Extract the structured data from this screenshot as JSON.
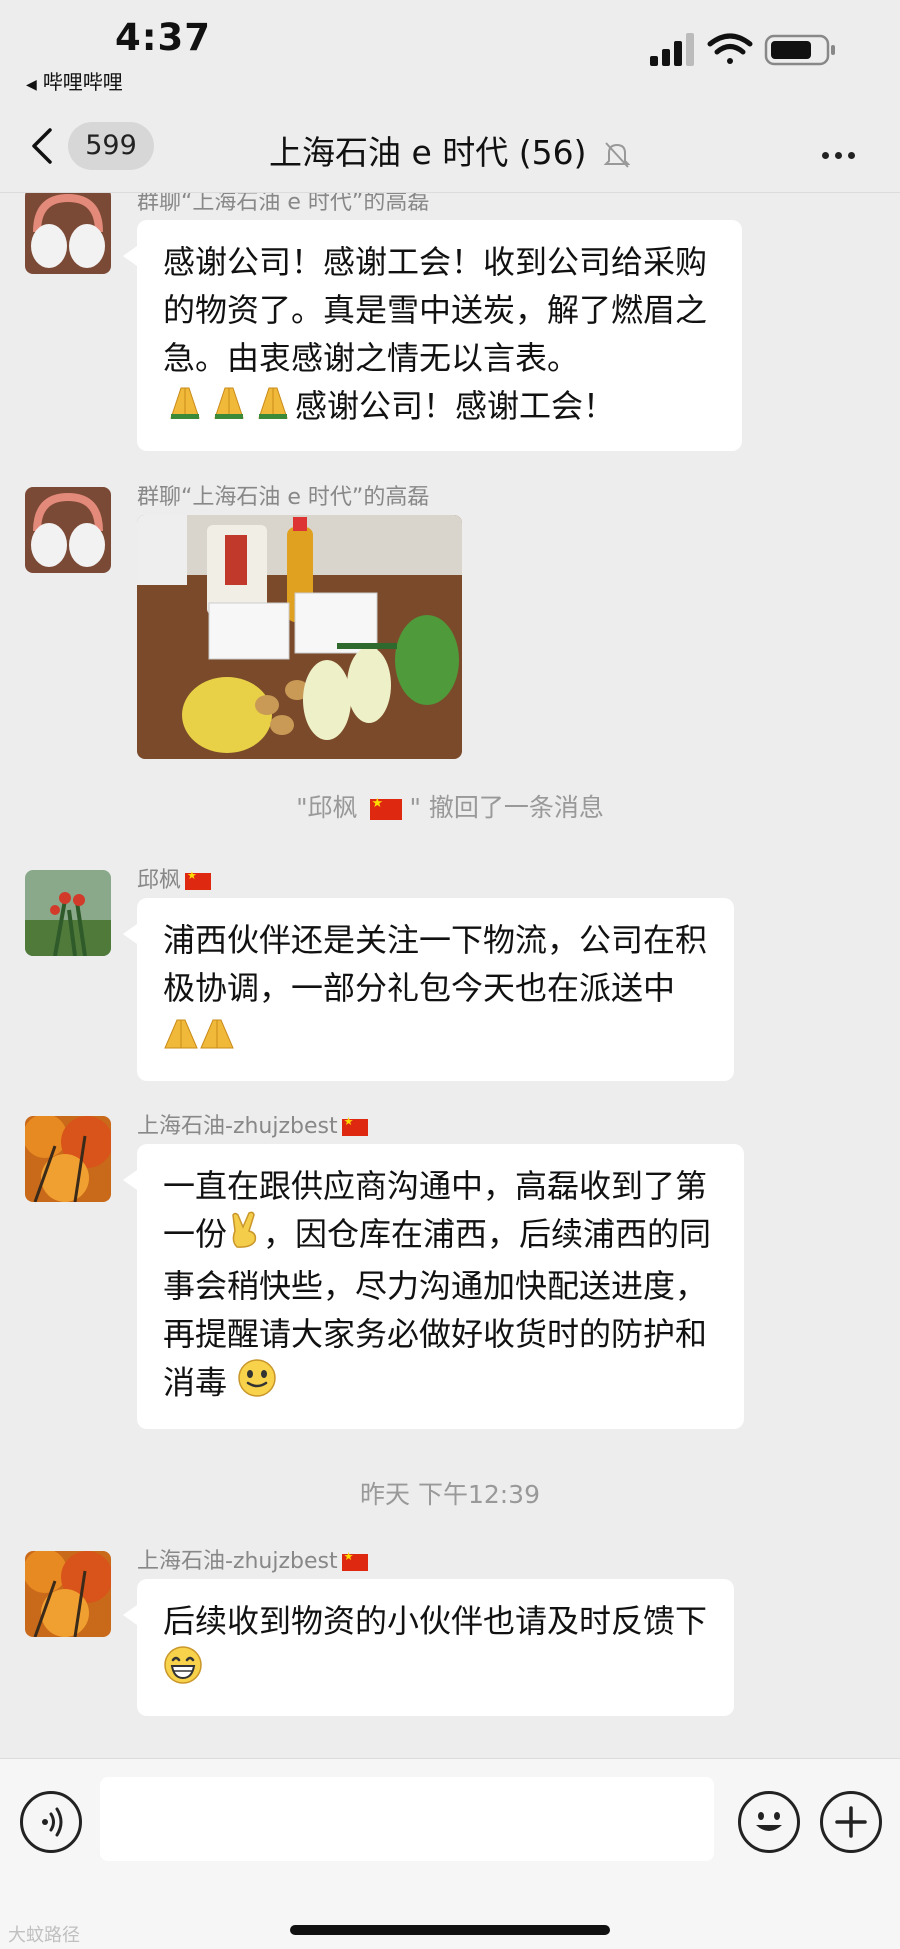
{
  "status_bar": {
    "time": "4:37",
    "back_app": "哔哩哔哩"
  },
  "nav": {
    "badge": "599",
    "title": "上海石油 e 时代 (56)"
  },
  "messages": [
    {
      "sender": "群聊“上海石油 e 时代”的高磊",
      "text": "感谢公司！感谢工会！收到公司给采购的物资了。真是雪中送炭，解了燃眉之急。由衷感谢之情无以言表。",
      "text_tail": "感谢公司！感谢工会！"
    },
    {
      "sender": "群聊“上海石油 e 时代”的高磊",
      "image_desc": "photo"
    },
    {
      "sender": "邱枫"
    },
    {
      "text": "浦西伙伴还是关注一下物流，公司在积极协调，一部分礼包今天也在派送中"
    },
    {
      "sender": "上海石油-zhujzbest",
      "text": "一直在跟供应商沟通中，高磊收到了第一份",
      "text_tail": "，因仓库在浦西，后续浦西的同事会稍快些，尽力沟通加快配送进度，再提醒请大家务必做好收货时的防护和消毒"
    },
    {
      "sender": "上海石油-zhujzbest",
      "text": "后续收到物资的小伙伴也请及时反馈下"
    }
  ],
  "system_notes": {
    "recall_prefix": "\"邱枫",
    "recall_suffix": "\" 撤回了一条消息",
    "timestamp": "昨天 下午12:39"
  },
  "watermark": "大蚊路径",
  "colors": {
    "background": "#ededed",
    "bubble": "#ffffff",
    "meta_text": "#999999"
  }
}
